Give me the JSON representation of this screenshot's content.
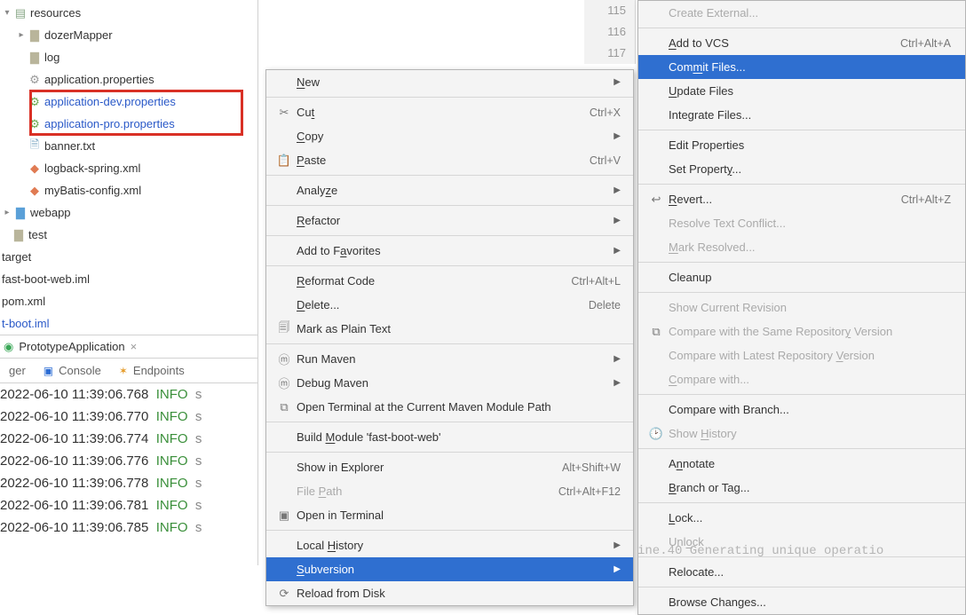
{
  "tree": {
    "resources": "resources",
    "dozerMapper": "dozerMapper",
    "log": "log",
    "app_props": "application.properties",
    "app_dev": "application-dev.properties",
    "app_pro": "application-pro.properties",
    "banner": "banner.txt",
    "logback": "logback-spring.xml",
    "mybatis": "myBatis-config.xml",
    "webapp": "webapp",
    "test": "test",
    "target": "target",
    "fbw_iml": "fast-boot-web.iml",
    "pom": "pom.xml",
    "t_boot_iml": "t-boot.iml"
  },
  "runTab": "PrototypeApplication",
  "toolTabs": {
    "debugger": "ger",
    "console": "Console",
    "endpoints": "Endpoints"
  },
  "gutter": [
    "115",
    "116",
    "117"
  ],
  "logs": [
    {
      "ts": "2022-06-10 11:39:06.768",
      "lv": "INFO",
      "tail": "  s"
    },
    {
      "ts": "2022-06-10 11:39:06.770",
      "lv": "INFO",
      "tail": "  s"
    },
    {
      "ts": "2022-06-10 11:39:06.774",
      "lv": "INFO",
      "tail": "  s"
    },
    {
      "ts": "2022-06-10 11:39:06.776",
      "lv": "INFO",
      "tail": "  s"
    },
    {
      "ts": "2022-06-10 11:39:06.778",
      "lv": "INFO",
      "tail": "  s"
    },
    {
      "ts": "2022-06-10 11:39:06.781",
      "lv": "INFO",
      "tail": "  s"
    },
    {
      "ts": "2022-06-10 11:39:06.785",
      "lv": "INFO",
      "tail": "  s"
    }
  ],
  "ctx": {
    "new": "New",
    "cut": "Cut",
    "copy": "Copy",
    "paste": "Paste",
    "analyze": "Analyze",
    "refactor": "Refactor",
    "fav": "Add to Favorites",
    "reformat": "Reformat Code",
    "delete": "Delete...",
    "plain": "Mark as Plain Text",
    "runmvn": "Run Maven",
    "dbgmvn": "Debug Maven",
    "openterm": "Open Terminal at the Current Maven Module Path",
    "buildmod": "Build Module 'fast-boot-web'",
    "showexp": "Show in Explorer",
    "filepath": "File Path",
    "opent": "Open in Terminal",
    "localhist": "Local History",
    "svn": "Subversion",
    "reload": "Reload from Disk",
    "sc_cut": "Ctrl+X",
    "sc_paste": "Ctrl+V",
    "sc_reformat": "Ctrl+Alt+L",
    "sc_del": "Delete",
    "sc_showexp": "Alt+Shift+W",
    "sc_filepath": "Ctrl+Alt+F12"
  },
  "sub": {
    "create_ext": "Create External...",
    "add_vcs": "Add to VCS",
    "sc_add": "Ctrl+Alt+A",
    "commit": "Commit Files...",
    "update": "Update Files",
    "integrate": "Integrate Files...",
    "edit_props": "Edit Properties",
    "set_prop": "Set Property...",
    "revert": "Revert...",
    "sc_revert": "Ctrl+Alt+Z",
    "resolve": "Resolve Text Conflict...",
    "mark_res": "Mark Resolved...",
    "cleanup": "Cleanup",
    "show_rev": "Show Current Revision",
    "cmp_same": "Compare with the Same Repository Version",
    "cmp_latest": "Compare with Latest Repository Version",
    "cmp_with": "Compare with...",
    "cmp_branch": "Compare with Branch...",
    "show_hist": "Show History",
    "annotate": "Annotate",
    "branch": "Branch or Tag...",
    "lock": "Lock...",
    "unlock": "Unlock",
    "relocate": "Relocate...",
    "browse": "Browse Changes..."
  },
  "bgCode": "ine.40     Generating  unique  operatio"
}
